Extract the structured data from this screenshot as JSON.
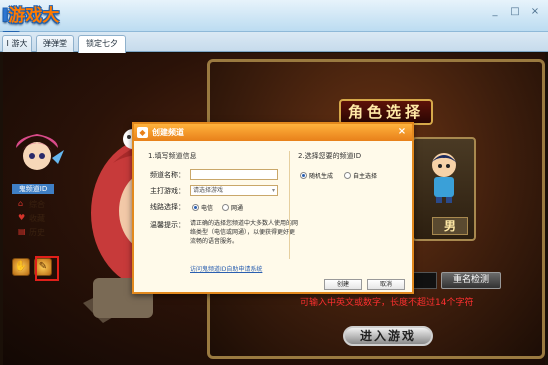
{
  "app": {
    "logo_text": "游戏大厅",
    "logo_prefix": "I"
  },
  "tabs": [
    {
      "label": "I 游大厅"
    },
    {
      "label": "弹弹堂"
    },
    {
      "label": "锁定七夕"
    }
  ],
  "window_controls": [
    "_",
    "□",
    "×"
  ],
  "sidebar": {
    "user_label": "鬼频道ID",
    "items": [
      {
        "label": "综合",
        "icon": "home-icon"
      },
      {
        "label": "收藏",
        "icon": "heart-icon"
      },
      {
        "label": "历史",
        "icon": "doc-icon"
      }
    ]
  },
  "game": {
    "role_title": "角色选择",
    "gender": "男",
    "name_check": "重名检测",
    "name_hint": "可输入中英文或数字，长度不超过14个字符",
    "enter_game": "进入游戏"
  },
  "dialog": {
    "title": "创建频道",
    "close": "×",
    "section1": "1.填写频道信息",
    "section2": "2.选择您要的频道ID",
    "channel_name_label": "频道名称：",
    "channel_name_value": "",
    "main_game_label": "主打游戏：",
    "main_game_value": "请选择游戏",
    "line_label": "线路选择：",
    "line_options": [
      {
        "label": "电信",
        "selected": true
      },
      {
        "label": "网通",
        "selected": false
      }
    ],
    "id_options": [
      {
        "label": "随机生成",
        "selected": true
      },
      {
        "label": "自主选择",
        "selected": false
      }
    ],
    "tip_label": "温馨提示：",
    "tip_text": "请正确的选择您频道中大多数人使用的网络类型（电信或网通），以便获得更好更流畅的语音服务。",
    "link_text": "访问鬼频道ID自助申请系统",
    "create_button": "创建",
    "cancel_button": "取消"
  }
}
